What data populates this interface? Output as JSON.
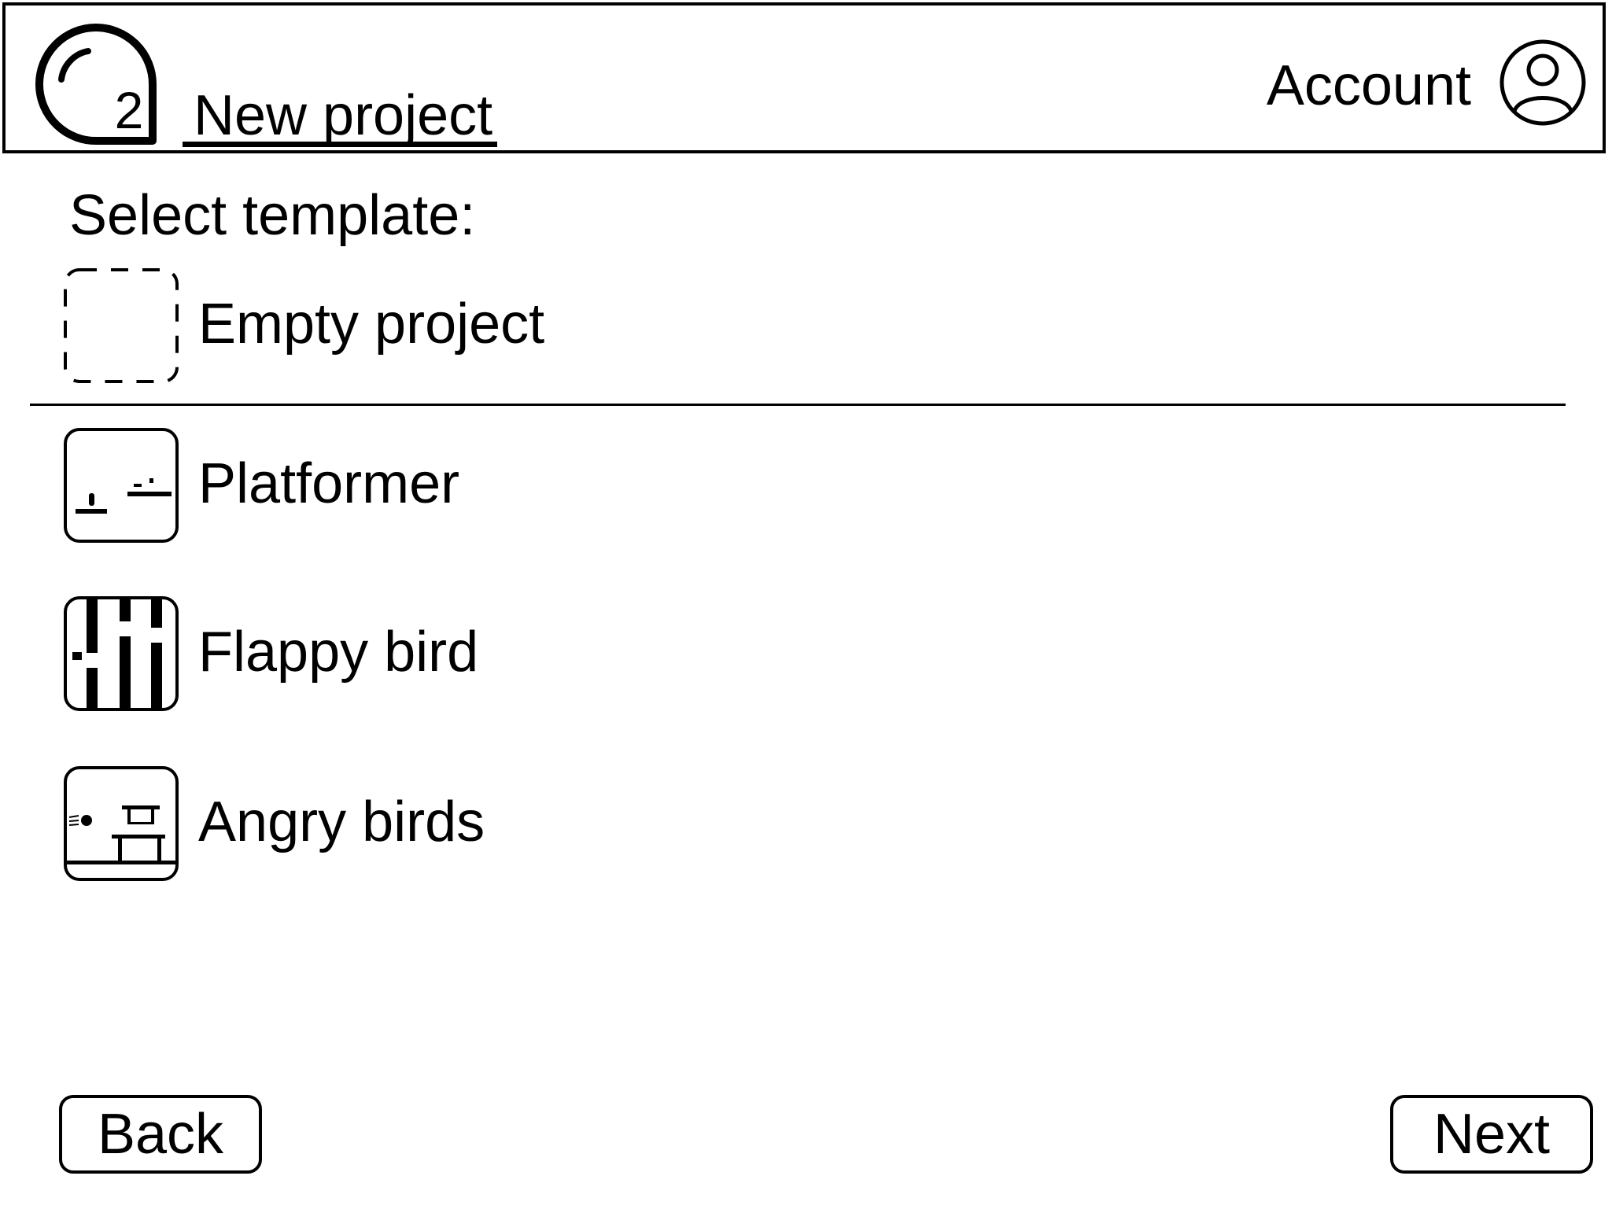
{
  "header": {
    "logo_icon": "app-logo-icon",
    "logo_digit": "2",
    "active_tab_label": "New project",
    "account_label": "Account",
    "account_icon": "user-circle-icon"
  },
  "main": {
    "heading": "Select template:",
    "templates": [
      {
        "label": "Empty project",
        "icon": "empty-dashed-square-icon"
      },
      {
        "label": "Platformer",
        "icon": "platformer-thumbnail-icon"
      },
      {
        "label": "Flappy bird",
        "icon": "flappy-bird-thumbnail-icon"
      },
      {
        "label": "Angry birds",
        "icon": "angry-birds-thumbnail-icon"
      }
    ]
  },
  "footer": {
    "back_label": "Back",
    "next_label": "Next"
  }
}
